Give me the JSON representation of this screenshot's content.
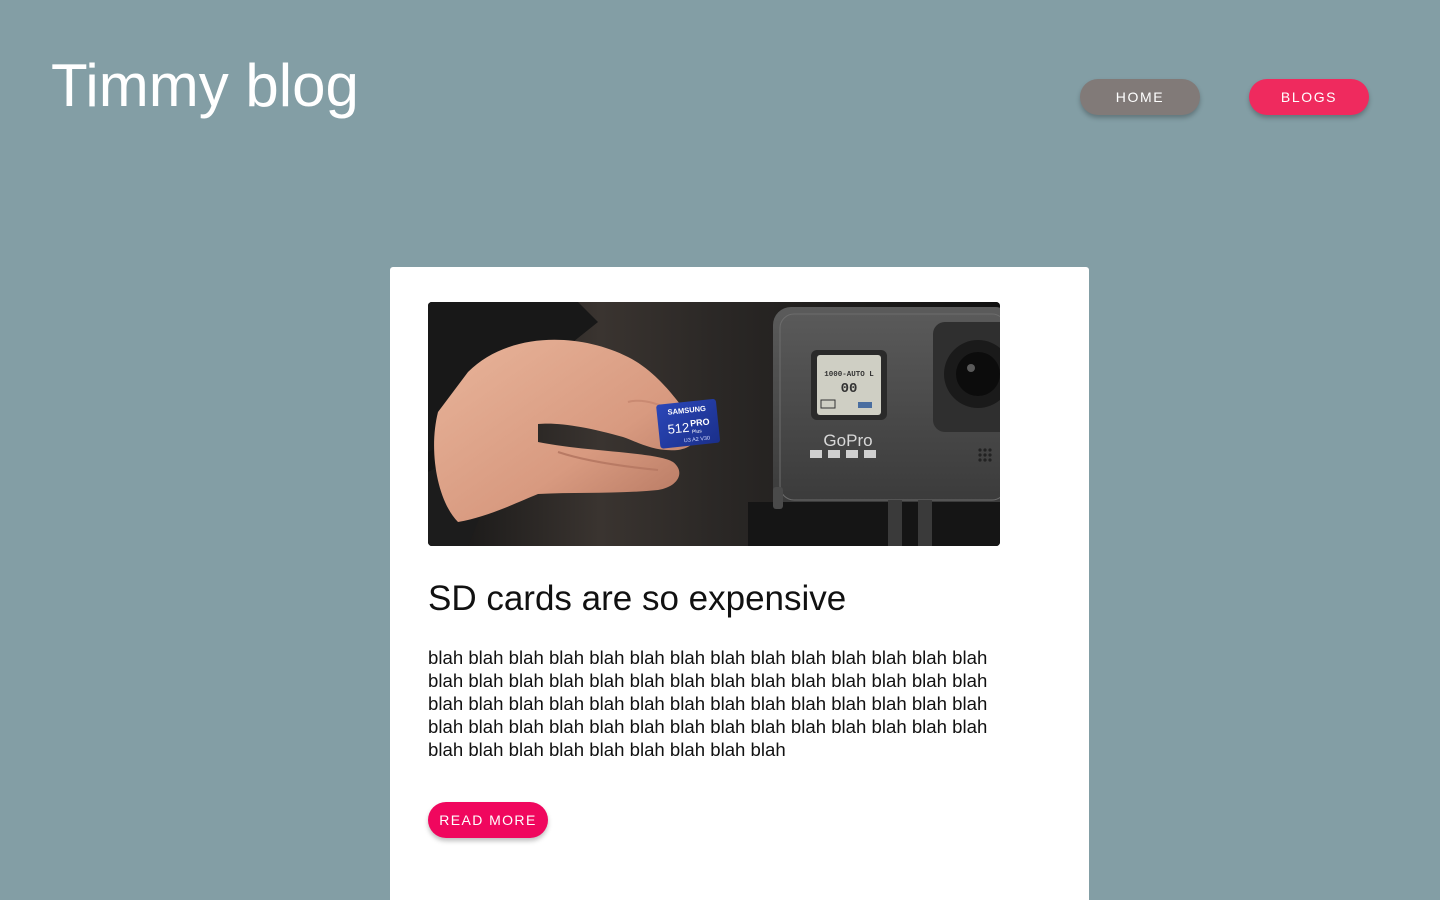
{
  "header": {
    "title": "Timmy blog",
    "nav": {
      "home_label": "HOME",
      "blogs_label": "BLOGS"
    }
  },
  "post": {
    "image_alt": "Hand holding a Samsung 512 PRO Plus microSD card next to a GoPro camera",
    "image_text": {
      "card_brand": "SAMSUNG",
      "card_capacity": "512",
      "card_model": "PRO",
      "card_sub": "Plus",
      "card_specs": "U3 A2 V30",
      "camera_brand": "GoPro",
      "camera_screen_line1": "1000-AUTO L",
      "camera_screen_line2": "00"
    },
    "title": "SD cards are so expensive",
    "body": "blah blah blah blah blah blah blah blah blah blah blah blah blah blah blah blah blah blah blah blah blah blah blah blah blah blah blah blah blah blah blah blah blah blah blah blah blah blah blah blah blah blah blah blah blah blah blah blah blah blah blah blah blah blah blah blah blah blah blah blah blah blah blah blah blah",
    "read_more_label": "READ MORE"
  },
  "colors": {
    "background": "#839ea5",
    "home_button": "#817a78",
    "blogs_button": "#ef2a5e",
    "read_more_button": "#f0075e",
    "card": "#ffffff"
  }
}
